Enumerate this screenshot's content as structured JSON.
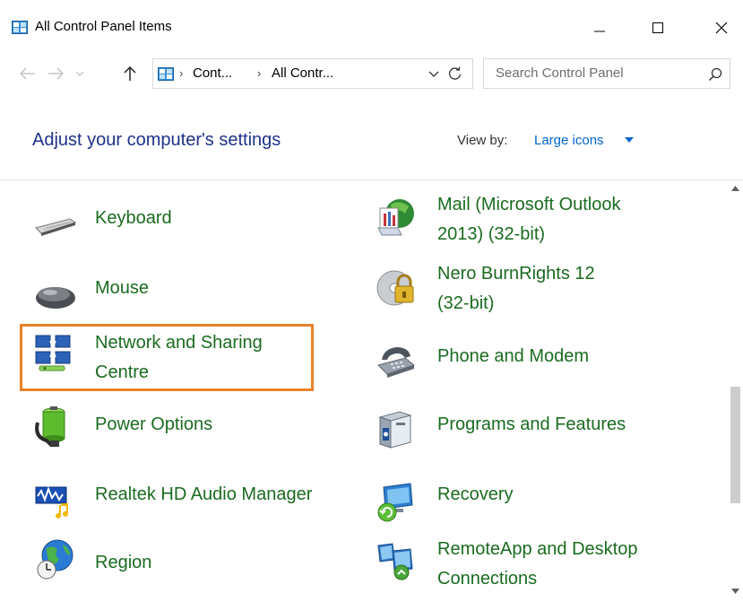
{
  "window": {
    "title": "All Control Panel Items",
    "controls": {
      "minimize": "minimize",
      "maximize": "maximize",
      "close": "close"
    }
  },
  "address": {
    "crumbs": [
      "Cont...",
      "All Contr..."
    ],
    "separator": "›"
  },
  "search": {
    "placeholder": "Search Control Panel"
  },
  "header": {
    "title": "Adjust your computer's settings",
    "view_by_label": "View by:",
    "view_by_value": "Large icons"
  },
  "colors": {
    "link_green": "#1a6b20",
    "title_blue": "#1e3287",
    "highlight_orange": "#e8822a",
    "view_blue": "#0066cc"
  },
  "items": [
    {
      "line1": "Keyboard",
      "line2": "",
      "icon": "keyboard-icon"
    },
    {
      "line1": "Mail (Microsoft Outlook",
      "line2": "2013) (32-bit)",
      "icon": "mail-icon"
    },
    {
      "line1": "Mouse",
      "line2": "",
      "icon": "mouse-icon"
    },
    {
      "line1": "Nero BurnRights 12",
      "line2": "(32-bit)",
      "icon": "lock-disc-icon"
    },
    {
      "line1": "Network and Sharing",
      "line2": "Centre",
      "icon": "network-icon"
    },
    {
      "line1": "Phone and Modem",
      "line2": "",
      "icon": "phone-icon"
    },
    {
      "line1": "Power Options",
      "line2": "",
      "icon": "battery-icon"
    },
    {
      "line1": "Programs and Features",
      "line2": "",
      "icon": "programs-icon"
    },
    {
      "line1": "Realtek HD Audio Manager",
      "line2": "",
      "icon": "audio-icon"
    },
    {
      "line1": "Recovery",
      "line2": "",
      "icon": "recovery-icon"
    },
    {
      "line1": "Region",
      "line2": "",
      "icon": "globe-clock-icon"
    },
    {
      "line1": "RemoteApp and Desktop",
      "line2": "Connections",
      "icon": "remote-icon"
    }
  ]
}
